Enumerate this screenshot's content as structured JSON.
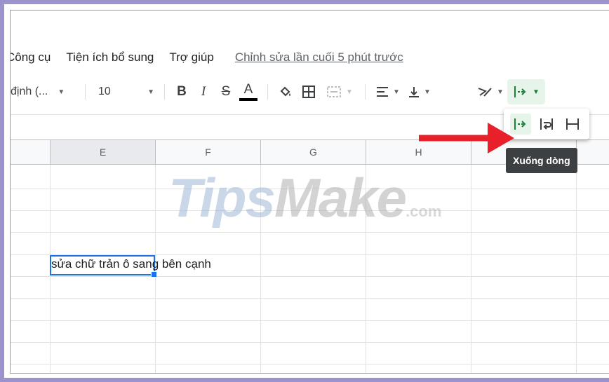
{
  "menu": {
    "items": [
      "Công cụ",
      "Tiện ích bổ sung",
      "Trợ giúp"
    ],
    "last_edit": "Chỉnh sửa lần cuối 5 phút trước"
  },
  "toolbar": {
    "font_name": "định (...",
    "font_size": "10",
    "bold": "B",
    "italic": "I",
    "strikethrough": "S",
    "text_color_label": "A",
    "text_color": "#000000"
  },
  "columns": [
    "E",
    "F",
    "G",
    "H"
  ],
  "selected_column": "E",
  "cell": {
    "text": "sửa chữ trản ô sang bên cạnh"
  },
  "wrap_popup": {
    "options": [
      "wrap-icon",
      "overflow-icon",
      "clip-icon"
    ],
    "tooltip": "Xuống dòng"
  },
  "watermark": {
    "part1": "Tips",
    "part2": "Make",
    "part3": ".com"
  },
  "colors": {
    "accent_green": "#188038",
    "selection_blue": "#1a73e8",
    "arrow_red": "#e8202a",
    "frame_purple": "#9b93cc"
  }
}
